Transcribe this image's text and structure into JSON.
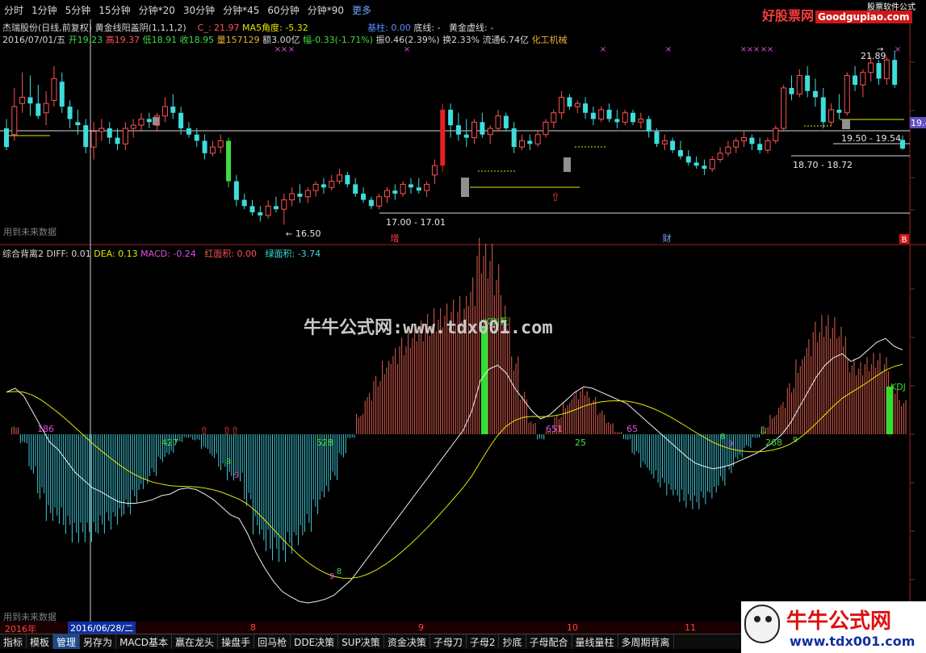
{
  "periods": [
    "分时",
    "1分钟",
    "5分钟",
    "15分钟",
    "分钟*20",
    "30分钟",
    "分钟*45",
    "60分钟",
    "分钟*90",
    "更多"
  ],
  "brand": {
    "name": "好股票网",
    "site": "Goodgupiao.com",
    "tag": "股票软件公式"
  },
  "info": {
    "stock": "杰瑞股份(日线,前复权)",
    "formula": "黄金线阳盖阴(1,1,1,2)",
    "c_label": "C_: 21.97",
    "ma5": "MA5角度: -5.32",
    "base_label": "基柱: 0.00",
    "bottom_label": "底线: -",
    "gold_label": "黄金虚线: -",
    "date": "2016/07/01/五",
    "open": "开19.23",
    "high": "高19.37",
    "low": "低18.91",
    "close": "收18.95",
    "vol": "量157129",
    "amount": "额3.00亿",
    "change": "幅-0.33(-1.71%)",
    "amplitude": "振0.46(2.39%)",
    "turnover": "换2.33%",
    "float": "流通6.74亿",
    "sector": "化工机械"
  },
  "price_labels": {
    "high": "21.89",
    "low": "16.50",
    "range1": "17.00 - 17.01",
    "range2": "18.70 - 18.72",
    "range3": "19.50 - 19.54",
    "cur": "19.4",
    "mark_zeng": "增",
    "mark_cai": "财",
    "mark_b": "B"
  },
  "future_text": "用到未来数据",
  "indicator": {
    "name": "综合背离2",
    "diff": "DIFF: 0.01",
    "dea": "DEA: 0.13",
    "macd": "MACD: -0.24",
    "red_area": "红面积: 0.00",
    "green_area": "绿面积: -3.74"
  },
  "ind_labels": [
    "186",
    "427",
    "528",
    "651",
    "25",
    "65",
    "268"
  ],
  "ind_markers": [
    "KDJ死",
    "KDJ",
    "8",
    "9",
    "8",
    "9",
    "8",
    "9",
    "9"
  ],
  "watermark": "牛牛公式网:www.tdx001.com",
  "dates": [
    "2016年",
    "8",
    "9",
    "10",
    "11"
  ],
  "date_cursor": "2016/06/28/二",
  "tabs": [
    "指标",
    "模板",
    "管理",
    "另存为",
    "MACD基本",
    "赢在龙头",
    "操盘手",
    "回马枪",
    "DDE决策",
    "SUP决策",
    "资金决策",
    "子母刀",
    "子母2",
    "抄底",
    "子母配合",
    "量线量柱",
    "多周期背离"
  ],
  "active_tab": "管理",
  "logo": {
    "title": "牛牛公式网",
    "url": "www.tdx001.com"
  },
  "colors": {
    "up": "#ff5252",
    "down": "#3fdcdc",
    "yellow": "#e6e600",
    "white": "#e8e8e8"
  },
  "chart_data": {
    "type": "candlestick",
    "ohlc": [
      [
        19.6,
        19.9,
        18.9,
        19.0
      ],
      [
        19.4,
        20.9,
        19.2,
        20.3
      ],
      [
        20.4,
        21.4,
        20.1,
        20.6
      ],
      [
        20.6,
        21.3,
        20.0,
        20.4
      ],
      [
        20.4,
        21.0,
        19.9,
        20.0
      ],
      [
        20.1,
        20.8,
        19.7,
        20.4
      ],
      [
        20.5,
        21.6,
        20.3,
        21.2
      ],
      [
        21.1,
        21.4,
        20.1,
        20.3
      ],
      [
        20.3,
        20.5,
        19.6,
        19.9
      ],
      [
        19.8,
        20.2,
        19.4,
        19.7
      ],
      [
        19.7,
        19.9,
        18.8,
        19.0
      ],
      [
        19.0,
        19.8,
        18.6,
        19.5
      ],
      [
        19.5,
        19.9,
        19.2,
        19.6
      ],
      [
        19.6,
        19.8,
        19.1,
        19.3
      ],
      [
        19.3,
        19.6,
        18.9,
        19.1
      ],
      [
        19.1,
        19.8,
        18.9,
        19.6
      ],
      [
        19.6,
        19.9,
        19.3,
        19.7
      ],
      [
        19.7,
        20.1,
        19.5,
        19.9
      ],
      [
        19.9,
        20.1,
        19.6,
        19.8
      ],
      [
        19.7,
        20.1,
        19.5,
        20.0
      ],
      [
        20.0,
        20.6,
        19.8,
        20.3
      ],
      [
        20.3,
        20.7,
        19.9,
        20.1
      ],
      [
        20.1,
        20.3,
        19.4,
        19.6
      ],
      [
        19.6,
        19.8,
        19.3,
        19.4
      ],
      [
        19.4,
        19.6,
        19.0,
        19.2
      ],
      [
        19.2,
        19.4,
        18.6,
        18.8
      ],
      [
        18.8,
        19.2,
        18.7,
        19.0
      ],
      [
        19.0,
        19.4,
        18.8,
        19.2
      ],
      [
        19.2,
        19.3,
        17.7,
        17.9
      ],
      [
        17.9,
        18.1,
        17.1,
        17.3
      ],
      [
        17.3,
        17.5,
        17.0,
        17.1
      ],
      [
        17.1,
        17.3,
        16.8,
        16.9
      ],
      [
        16.9,
        17.1,
        16.6,
        16.8
      ],
      [
        16.8,
        17.3,
        16.7,
        17.1
      ],
      [
        17.1,
        17.4,
        16.9,
        17.0
      ],
      [
        17.0,
        17.5,
        16.5,
        17.3
      ],
      [
        17.3,
        17.7,
        17.1,
        17.5
      ],
      [
        17.5,
        17.8,
        17.2,
        17.4
      ],
      [
        17.4,
        17.7,
        17.2,
        17.6
      ],
      [
        17.6,
        17.9,
        17.4,
        17.8
      ],
      [
        17.8,
        18.0,
        17.5,
        17.7
      ],
      [
        17.7,
        18.1,
        17.6,
        17.9
      ],
      [
        17.9,
        18.3,
        17.8,
        18.1
      ],
      [
        18.1,
        18.2,
        17.7,
        17.8
      ],
      [
        17.8,
        18.0,
        17.4,
        17.5
      ],
      [
        17.5,
        17.7,
        17.2,
        17.3
      ],
      [
        17.3,
        17.4,
        17.0,
        17.1
      ],
      [
        17.1,
        17.5,
        17.0,
        17.4
      ],
      [
        17.4,
        17.7,
        17.2,
        17.6
      ],
      [
        17.6,
        17.8,
        17.3,
        17.5
      ],
      [
        17.5,
        17.9,
        17.4,
        17.8
      ],
      [
        17.8,
        18.0,
        17.5,
        17.7
      ],
      [
        17.7,
        18.0,
        17.5,
        17.6
      ],
      [
        17.6,
        17.9,
        17.4,
        17.8
      ],
      [
        18.1,
        18.6,
        17.8,
        18.4
      ],
      [
        18.4,
        20.4,
        18.2,
        20.2
      ],
      [
        20.2,
        20.4,
        19.3,
        19.7
      ],
      [
        19.7,
        20.1,
        19.2,
        19.4
      ],
      [
        19.4,
        19.9,
        19.0,
        19.3
      ],
      [
        19.3,
        19.9,
        19.1,
        19.8
      ],
      [
        19.8,
        20.1,
        19.3,
        19.4
      ],
      [
        19.4,
        19.7,
        19.1,
        19.6
      ],
      [
        19.6,
        20.2,
        19.5,
        20.0
      ],
      [
        20.0,
        20.1,
        19.5,
        19.6
      ],
      [
        19.6,
        19.8,
        18.8,
        19.0
      ],
      [
        19.0,
        19.4,
        18.9,
        19.2
      ],
      [
        19.2,
        19.4,
        18.9,
        19.1
      ],
      [
        19.1,
        19.5,
        19.0,
        19.4
      ],
      [
        19.4,
        19.9,
        19.3,
        19.8
      ],
      [
        19.8,
        20.2,
        19.6,
        20.1
      ],
      [
        20.1,
        20.8,
        19.9,
        20.6
      ],
      [
        20.6,
        20.7,
        20.2,
        20.3
      ],
      [
        20.3,
        20.5,
        20.1,
        20.4
      ],
      [
        20.4,
        20.6,
        19.9,
        20.1
      ],
      [
        20.1,
        20.3,
        19.7,
        19.9
      ],
      [
        19.9,
        20.3,
        19.8,
        20.2
      ],
      [
        20.2,
        20.4,
        19.8,
        19.9
      ],
      [
        19.9,
        20.2,
        19.6,
        19.8
      ],
      [
        19.8,
        20.2,
        19.7,
        20.1
      ],
      [
        20.1,
        20.2,
        19.7,
        19.8
      ],
      [
        19.8,
        20.1,
        19.6,
        19.9
      ],
      [
        19.9,
        20.0,
        19.3,
        19.5
      ],
      [
        19.5,
        19.6,
        19.0,
        19.1
      ],
      [
        19.1,
        19.4,
        18.9,
        19.2
      ],
      [
        19.2,
        19.3,
        18.8,
        18.9
      ],
      [
        18.9,
        19.2,
        18.6,
        18.7
      ],
      [
        18.7,
        18.9,
        18.4,
        18.5
      ],
      [
        18.5,
        18.7,
        18.3,
        18.4
      ],
      [
        18.4,
        18.6,
        18.1,
        18.3
      ],
      [
        18.3,
        18.7,
        18.2,
        18.6
      ],
      [
        18.6,
        19.0,
        18.5,
        18.8
      ],
      [
        18.8,
        19.2,
        18.7,
        19.0
      ],
      [
        19.0,
        19.3,
        18.8,
        19.2
      ],
      [
        19.2,
        19.5,
        19.0,
        19.3
      ],
      [
        19.3,
        19.4,
        18.9,
        19.1
      ],
      [
        19.1,
        19.3,
        18.8,
        18.9
      ],
      [
        18.9,
        19.3,
        18.8,
        19.2
      ],
      [
        19.2,
        19.7,
        19.1,
        19.6
      ],
      [
        19.6,
        21.0,
        19.5,
        20.9
      ],
      [
        20.9,
        21.3,
        20.5,
        20.7
      ],
      [
        20.7,
        21.5,
        20.6,
        21.3
      ],
      [
        21.3,
        21.6,
        20.6,
        20.8
      ],
      [
        20.8,
        21.2,
        20.3,
        20.6
      ],
      [
        20.6,
        20.9,
        19.6,
        19.8
      ],
      [
        19.8,
        20.4,
        19.7,
        20.2
      ],
      [
        20.2,
        20.7,
        19.9,
        20.1
      ],
      [
        20.1,
        21.4,
        20.0,
        21.3
      ],
      [
        21.3,
        21.6,
        20.8,
        21.0
      ],
      [
        21.0,
        21.5,
        20.6,
        21.4
      ],
      [
        21.4,
        21.9,
        21.1,
        21.7
      ],
      [
        21.7,
        21.8,
        21.0,
        21.2
      ],
      [
        21.2,
        21.9,
        21.0,
        21.8
      ],
      [
        21.8,
        22.1,
        20.9,
        21.0
      ],
      [
        19.23,
        19.37,
        18.91,
        18.95
      ]
    ],
    "diff": [
      0.55,
      0.6,
      0.5,
      0.3,
      0.1,
      -0.1,
      -0.2,
      -0.35,
      -0.5,
      -0.6,
      -0.7,
      -0.75,
      -0.82,
      -0.88,
      -0.9,
      -0.9,
      -0.88,
      -0.85,
      -0.8,
      -0.78,
      -0.72,
      -0.7,
      -0.72,
      -0.78,
      -0.85,
      -0.95,
      -1.05,
      -1.1,
      -1.3,
      -1.55,
      -1.75,
      -1.92,
      -2.05,
      -2.12,
      -2.18,
      -2.2,
      -2.18,
      -2.15,
      -2.1,
      -2.0,
      -1.9,
      -1.75,
      -1.6,
      -1.45,
      -1.3,
      -1.15,
      -1.0,
      -0.85,
      -0.7,
      -0.55,
      -0.4,
      -0.25,
      -0.1,
      0.05,
      0.3,
      0.7,
      0.85,
      0.9,
      0.8,
      0.6,
      0.45,
      0.3,
      0.2,
      0.25,
      0.35,
      0.45,
      0.55,
      0.62,
      0.6,
      0.55,
      0.5,
      0.45,
      0.4,
      0.3,
      0.2,
      0.1,
      0.0,
      -0.1,
      -0.2,
      -0.3,
      -0.38,
      -0.42,
      -0.45,
      -0.43,
      -0.4,
      -0.35,
      -0.3,
      -0.25,
      -0.18,
      -0.1,
      0.0,
      0.15,
      0.35,
      0.55,
      0.75,
      0.9,
      1.0,
      1.05,
      0.95,
      1.0,
      1.1,
      1.2,
      1.25,
      1.15,
      1.1
    ]
  }
}
